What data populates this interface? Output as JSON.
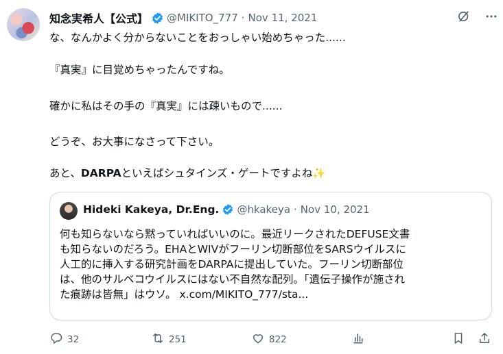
{
  "tweet": {
    "author_name": "知念実希人【公式】",
    "handle": "@MIKITO_777",
    "dot": "·",
    "date": "Nov 11, 2021",
    "lines": {
      "p1": "な、なんかよく分からないことをおっしゃい始めちゃった......",
      "p2": "『真実』に目覚めちゃったんですね。",
      "p3": "確かに私はその手の『真実』には疎いもので......",
      "p4": "どうぞ、お大事になさって下さい。",
      "p5_prefix": "あと、",
      "p5_bold": "DARPA",
      "p5_suffix": "といえばシュタインズ・ゲートですよね",
      "p5_emoji": "✨"
    }
  },
  "quote": {
    "author_name": "Hideki Kakeya, Dr.Eng.",
    "handle": "@hkakeya",
    "dot": "·",
    "date": "Nov 10, 2021",
    "lines": [
      "何も知らないなら黙っていればいいのに。最近リークされたDEFUSE文書",
      "も知らないのだろう。EHAとWIVがフーリン切断部位をSARSウイルスに",
      "人工的に挿入する研究計画をDARPAに提出していた。フーリン切断部位",
      "は、他のサルベコウイルスにはない不自然な配列。「遺伝子操作が施され",
      "た痕跡は皆無」はウソ。 x.com/MIKITO_777/sta..."
    ]
  },
  "actions": {
    "replies": "32",
    "reposts": "251",
    "likes": "822"
  },
  "colors": {
    "verified": "#1d9bf0",
    "secondary_text": "#536471",
    "border": "#cfd9de"
  },
  "icons": [
    "grok-icon",
    "more-icon",
    "reply-icon",
    "repost-icon",
    "like-icon",
    "views-icon",
    "bookmark-icon",
    "share-icon"
  ]
}
